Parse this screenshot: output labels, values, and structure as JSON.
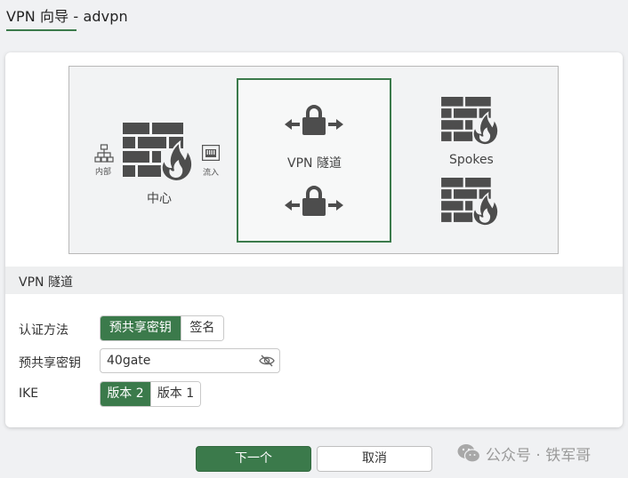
{
  "header": {
    "title": "VPN 向导 - advpn"
  },
  "diagram": {
    "hub_label": "中心",
    "internal_label": "内部",
    "inflow_label": "流入",
    "tunnel_label": "VPN 隧道",
    "spokes_label": "Spokes"
  },
  "section": {
    "title": "VPN 隧道"
  },
  "form": {
    "auth_method": {
      "label": "认证方法",
      "options": [
        "预共享密钥",
        "签名"
      ],
      "selected": "预共享密钥"
    },
    "psk": {
      "label": "预共享密钥",
      "value": "40gate"
    },
    "ike": {
      "label": "IKE",
      "options": [
        "版本 2",
        "版本 1"
      ],
      "selected": "版本 2"
    }
  },
  "footer": {
    "next_label": "下一个",
    "cancel_label": "取消"
  },
  "watermark": {
    "text": "公众号 · 铁军哥"
  },
  "colors": {
    "accent": "#3b7a4b",
    "icon_gray": "#4d4d4d",
    "background": "#f0f1f3"
  }
}
